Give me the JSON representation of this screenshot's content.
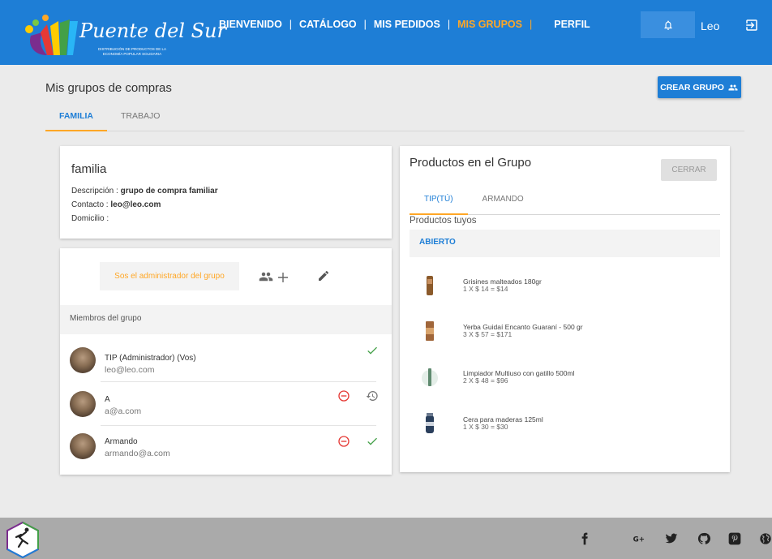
{
  "brand": {
    "name": "Puente del Sur",
    "tagline_line1": "Distribución de productos de la",
    "tagline_line2": "economía popular solidaria"
  },
  "nav": {
    "items": [
      {
        "label": "BIENVENIDO",
        "active": false
      },
      {
        "label": "CATÁLOGO",
        "active": false
      },
      {
        "label": "MIS PEDIDOS",
        "active": false
      },
      {
        "label": "MIS GRUPOS",
        "active": true
      },
      {
        "label": "PERFIL",
        "active": false
      }
    ],
    "separator": "|",
    "user_name": "Leo"
  },
  "page": {
    "title": "Mis grupos de compras",
    "create_group_label": "CREAR GRUPO",
    "tabs": [
      {
        "label": "FAMILIA",
        "active": true
      },
      {
        "label": "TRABAJO",
        "active": false
      }
    ]
  },
  "group": {
    "name": "familia",
    "description_label": "Descripción :",
    "description": "grupo de compra familiar",
    "contact_label": "Contacto :",
    "contact": "leo@leo.com",
    "address_label": "Domicilio :",
    "address": ""
  },
  "members": {
    "admin_notice": "Sos el administrador del grupo",
    "header": "Miembros del grupo",
    "list": [
      {
        "name": "TIP (Administrador) (Vos)",
        "email": "leo@leo.com",
        "status": "confirmed"
      },
      {
        "name": "A",
        "email": "a@a.com",
        "status": "pending"
      },
      {
        "name": "Armando",
        "email": "armando@a.com",
        "status": "confirmed"
      }
    ]
  },
  "products": {
    "title": "Productos en el Grupo",
    "close_label": "CERRAR",
    "tabs": [
      {
        "label": "TIP(TÚ)",
        "active": true
      },
      {
        "label": "ARMANDO",
        "active": false
      }
    ],
    "subtitle": "Productos tuyos",
    "status": "ABIERTO",
    "items": [
      {
        "name": "Grisines malteados 180gr",
        "price": "1 X $ 14 = $14",
        "thumb_color": "#8b5a2b"
      },
      {
        "name": "Yerba Guidaí Encanto Guaraní - 500 gr",
        "price": "3 X $ 57 = $171",
        "thumb_color": "#a0663a"
      },
      {
        "name": "Limpiador Multiuso con gatillo 500ml",
        "price": "2 X $ 48 = $96",
        "thumb_color": "#c9d8d0"
      },
      {
        "name": "Cera para maderas 125ml",
        "price": "1 X $ 30 = $30",
        "thumb_color": "#2a3f5c"
      }
    ]
  },
  "colors": {
    "primary": "#1e7ed6",
    "accent": "#ffa726",
    "success": "#43a047",
    "danger": "#e53935"
  }
}
